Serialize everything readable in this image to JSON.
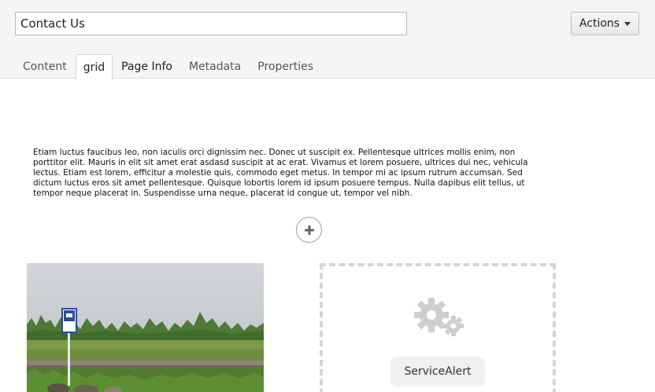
{
  "header": {
    "title_value": "Contact Us",
    "actions_label": "Actions"
  },
  "tabs": [
    {
      "label": "Content"
    },
    {
      "label": "grid"
    },
    {
      "label": "Page Info"
    },
    {
      "label": "Metadata"
    },
    {
      "label": "Properties"
    }
  ],
  "active_tab": "grid",
  "content": {
    "paragraph": "Etiam luctus faucibus leo, non iaculis orci dignissim nec. Donec ut suscipit ex. Pellentesque ultrices mollis enim, non porttitor elit. Mauris in elit sit amet erat asdasd suscipit at ac erat. Vivamus et lorem posuere, ultrices dui nec, vehicula lectus. Etiam est lorem, efficitur a molestie quis, commodo eget metus. In tempor mi ac ipsum rutrum accumsan. Sed dictum luctus eros sit amet pellentesque. Quisque lobortis lorem id ipsum posuere tempus. Nulla dapibus elit tellus, ut tempor neque placerat in. Suspendisse urna neque, placerat id congue ut, tempor vel nibh."
  },
  "grid": {
    "add_icon": "plus-icon",
    "module": {
      "icon": "gears-icon",
      "label": "ServiceAlert"
    }
  }
}
